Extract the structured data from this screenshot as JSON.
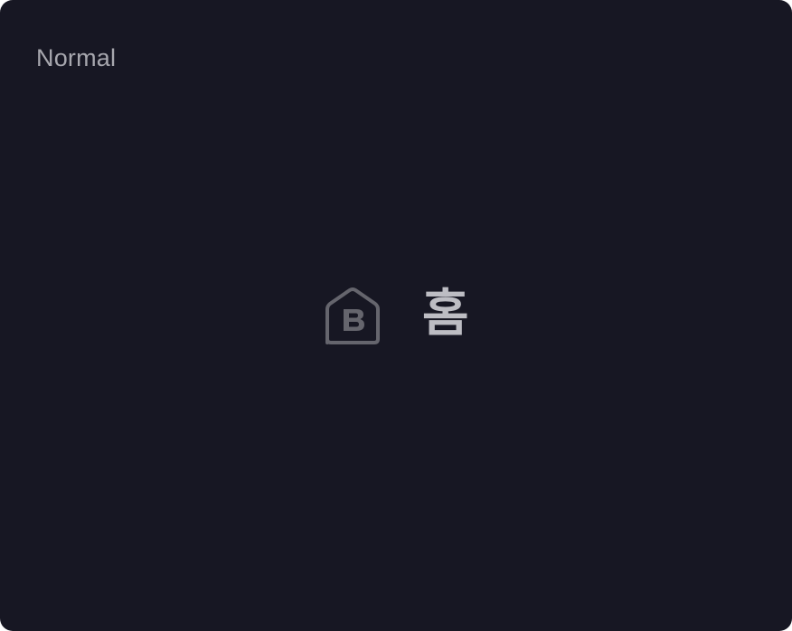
{
  "state_label": "Normal",
  "nav_item": {
    "icon": "home-b-icon",
    "label": "홈"
  },
  "colors": {
    "background": "#171723",
    "label_text": "#a7a7ae",
    "icon": "#65656d",
    "nav_text": "#bdbdc3"
  }
}
